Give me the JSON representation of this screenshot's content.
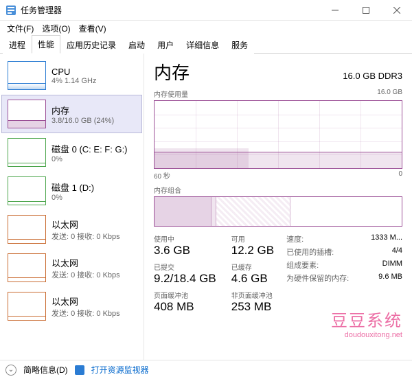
{
  "window": {
    "title": "任务管理器"
  },
  "menu": {
    "file": "文件(F)",
    "options": "选项(O)",
    "view": "查看(V)"
  },
  "tabs": [
    "进程",
    "性能",
    "应用历史记录",
    "启动",
    "用户",
    "详细信息",
    "服务"
  ],
  "sidebar": [
    {
      "title": "CPU",
      "sub": "4% 1.14 GHz"
    },
    {
      "title": "内存",
      "sub": "3.8/16.0 GB (24%)"
    },
    {
      "title": "磁盘 0 (C: E: F: G:)",
      "sub": "0%"
    },
    {
      "title": "磁盘 1 (D:)",
      "sub": "0%"
    },
    {
      "title": "以太网",
      "sub": "发送: 0 接收: 0 Kbps"
    },
    {
      "title": "以太网",
      "sub": "发送: 0 接收: 0 Kbps"
    },
    {
      "title": "以太网",
      "sub": "发送: 0 接收: 0 Kbps"
    }
  ],
  "main": {
    "title": "内存",
    "capacity": "16.0 GB DDR3",
    "usage_label": "内存使用量",
    "usage_max": "16.0 GB",
    "axis_left": "60 秒",
    "axis_right": "0",
    "composition_label": "内存组合"
  },
  "stats": {
    "in_use": {
      "label": "使用中",
      "value": "3.6 GB"
    },
    "available": {
      "label": "可用",
      "value": "12.2 GB"
    },
    "committed": {
      "label": "已提交",
      "value": "9.2/18.4 GB"
    },
    "cached": {
      "label": "已缓存",
      "value": "4.6 GB"
    },
    "paged": {
      "label": "页面缓冲池",
      "value": "408 MB"
    },
    "nonpaged": {
      "label": "非页面缓冲池",
      "value": "253 MB"
    }
  },
  "details": {
    "speed": {
      "k": "速度:",
      "v": "1333 M..."
    },
    "slots": {
      "k": "已使用的插槽:",
      "v": "4/4"
    },
    "form": {
      "k": "组成要素:",
      "v": "DIMM"
    },
    "reserved": {
      "k": "为硬件保留的内存:",
      "v": "9.6 MB"
    }
  },
  "footer": {
    "brief": "简略信息(D)",
    "monitor": "打开资源监视器"
  },
  "watermark": {
    "text": "豆豆系统",
    "url": "doudouxitong.net"
  },
  "chart_data": {
    "type": "area",
    "title": "内存使用量",
    "ylabel": "GB",
    "ylim": [
      0,
      16.0
    ],
    "xlabel": "秒",
    "xlim": [
      60,
      0
    ],
    "series": [
      {
        "name": "内存使用量 (GB)",
        "values": [
          4.1,
          4.1,
          4.1,
          4.1,
          4.1,
          4.1,
          4.1,
          4.1,
          4.0,
          3.8,
          3.8,
          3.8,
          3.8,
          3.8,
          3.8,
          3.8,
          3.8,
          3.8,
          3.8,
          3.8
        ]
      }
    ],
    "composition": {
      "in_use_gb": 3.6,
      "modified_gb": 0.3,
      "standby_gb": 4.6,
      "free_gb": 7.5,
      "total_gb": 16.0
    }
  }
}
